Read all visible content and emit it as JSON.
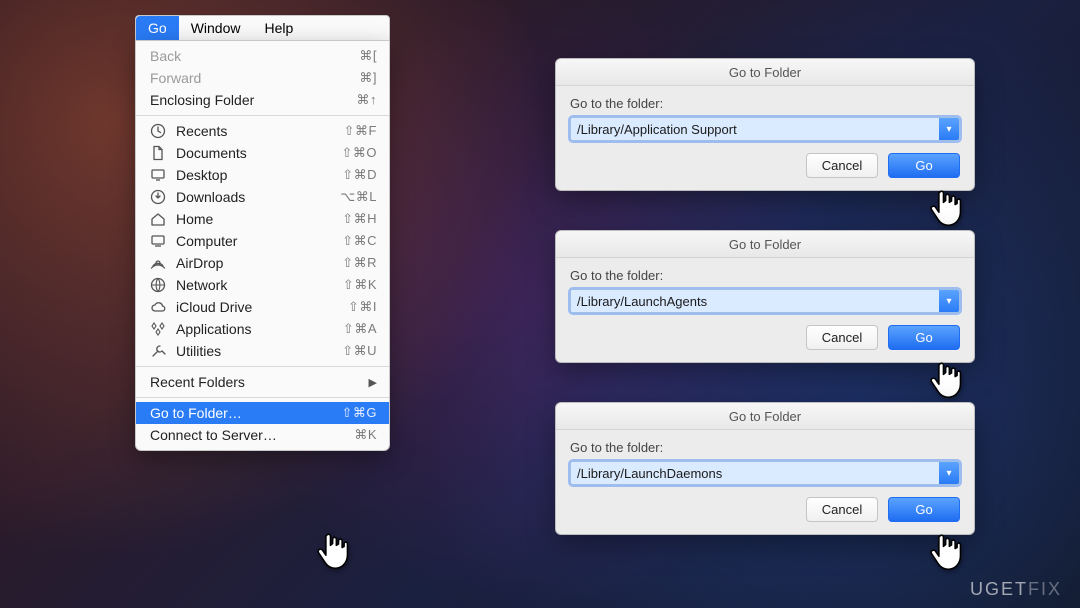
{
  "menubar": {
    "items": [
      {
        "label": "Go",
        "active": true
      },
      {
        "label": "Window"
      },
      {
        "label": "Help"
      }
    ]
  },
  "dropdown": {
    "section1": [
      {
        "label": "Back",
        "shortcut": "⌘[",
        "dim": true
      },
      {
        "label": "Forward",
        "shortcut": "⌘]",
        "dim": true
      },
      {
        "label": "Enclosing Folder",
        "shortcut": "⌘↑"
      }
    ],
    "section2": [
      {
        "label": "Recents",
        "shortcut": "⇧⌘F",
        "icon": "clock"
      },
      {
        "label": "Documents",
        "shortcut": "⇧⌘O",
        "icon": "doc"
      },
      {
        "label": "Desktop",
        "shortcut": "⇧⌘D",
        "icon": "desktop"
      },
      {
        "label": "Downloads",
        "shortcut": "⌥⌘L",
        "icon": "download"
      },
      {
        "label": "Home",
        "shortcut": "⇧⌘H",
        "icon": "home"
      },
      {
        "label": "Computer",
        "shortcut": "⇧⌘C",
        "icon": "computer"
      },
      {
        "label": "AirDrop",
        "shortcut": "⇧⌘R",
        "icon": "airdrop"
      },
      {
        "label": "Network",
        "shortcut": "⇧⌘K",
        "icon": "network"
      },
      {
        "label": "iCloud Drive",
        "shortcut": "⇧⌘I",
        "icon": "cloud"
      },
      {
        "label": "Applications",
        "shortcut": "⇧⌘A",
        "icon": "apps"
      },
      {
        "label": "Utilities",
        "shortcut": "⇧⌘U",
        "icon": "tools"
      }
    ],
    "section3": [
      {
        "label": "Recent Folders",
        "submenu": true
      }
    ],
    "section4": [
      {
        "label": "Go to Folder…",
        "shortcut": "⇧⌘G",
        "selected": true
      },
      {
        "label": "Connect to Server…",
        "shortcut": "⌘K"
      }
    ]
  },
  "sheets": [
    {
      "title": "Go to Folder",
      "prompt": "Go to the folder:",
      "value": "/Library/Application Support",
      "cancel": "Cancel",
      "go": "Go"
    },
    {
      "title": "Go to Folder",
      "prompt": "Go to the folder:",
      "value": "/Library/LaunchAgents",
      "cancel": "Cancel",
      "go": "Go"
    },
    {
      "title": "Go to Folder",
      "prompt": "Go to the folder:",
      "value": "/Library/LaunchDaemons",
      "cancel": "Cancel",
      "go": "Go"
    }
  ],
  "watermark": {
    "brand1": "UGET",
    "brand2": "FIX"
  }
}
